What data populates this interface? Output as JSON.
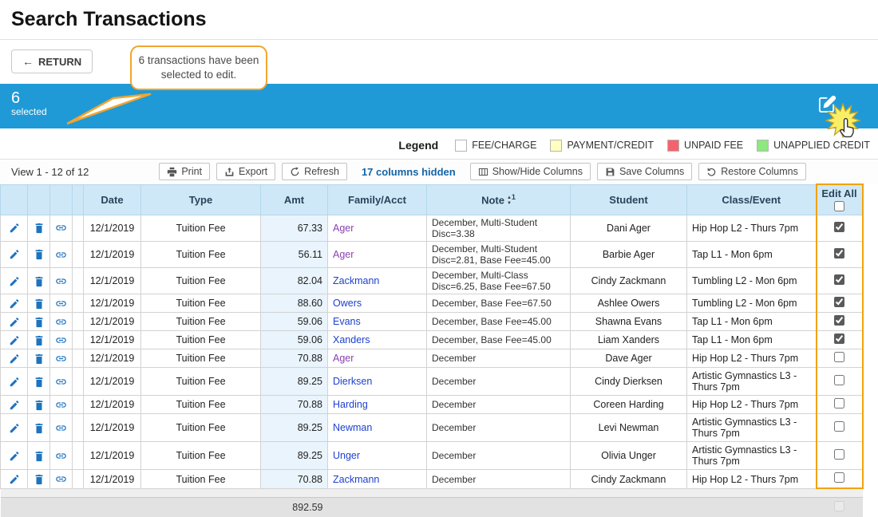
{
  "page_title": "Search Transactions",
  "return_button": {
    "label": "RETURN"
  },
  "callout": {
    "text": "6 transactions have been selected to edit."
  },
  "selection_bar": {
    "count": "6",
    "label": "selected"
  },
  "colors": {
    "selection_bar_blue": "#1f9ad6",
    "highlight_orange": "#f0a30a"
  },
  "legend": {
    "title": "Legend",
    "items": [
      {
        "label": "FEE/CHARGE",
        "color": "#ffffff"
      },
      {
        "label": "PAYMENT/CREDIT",
        "color": "#ffffc2"
      },
      {
        "label": "UNPAID FEE",
        "color": "#f4636d"
      },
      {
        "label": "UNAPPLIED CREDIT",
        "color": "#8ce87f"
      }
    ]
  },
  "toolbar": {
    "view_text": "View 1 - 12 of 12",
    "print_label": "Print",
    "export_label": "Export",
    "refresh_label": "Refresh",
    "columns_hidden_label": "17 columns hidden",
    "show_hide_label": "Show/Hide Columns",
    "save_label": "Save Columns",
    "restore_label": "Restore Columns"
  },
  "table": {
    "headers": {
      "date": "Date",
      "type": "Type",
      "amt": "Amt",
      "family": "Family/Acct",
      "note": "Note",
      "note_superscript": "1",
      "student": "Student",
      "class_event": "Class/Event",
      "edit_all": "Edit All"
    },
    "rows": [
      {
        "date": "12/1/2019",
        "type": "Tuition Fee",
        "amt": "67.33",
        "family": "Ager",
        "visited": true,
        "note": "December, Multi-Student Disc=3.38",
        "student": "Dani Ager",
        "class_event": "Hip Hop L2 - Thurs 7pm",
        "checked": true
      },
      {
        "date": "12/1/2019",
        "type": "Tuition Fee",
        "amt": "56.11",
        "family": "Ager",
        "visited": true,
        "note": "December, Multi-Student Disc=2.81, Base Fee=45.00",
        "student": "Barbie Ager",
        "class_event": "Tap L1 - Mon 6pm",
        "checked": true
      },
      {
        "date": "12/1/2019",
        "type": "Tuition Fee",
        "amt": "82.04",
        "family": "Zackmann",
        "visited": false,
        "note": "December, Multi-Class Disc=6.25, Base Fee=67.50",
        "student": "Cindy Zackmann",
        "class_event": "Tumbling L2 - Mon 6pm",
        "checked": true
      },
      {
        "date": "12/1/2019",
        "type": "Tuition Fee",
        "amt": "88.60",
        "family": "Owers",
        "visited": false,
        "note": "December, Base Fee=67.50",
        "student": "Ashlee Owers",
        "class_event": "Tumbling L2 - Mon 6pm",
        "checked": true
      },
      {
        "date": "12/1/2019",
        "type": "Tuition Fee",
        "amt": "59.06",
        "family": "Evans",
        "visited": false,
        "note": "December, Base Fee=45.00",
        "student": "Shawna Evans",
        "class_event": "Tap L1 - Mon 6pm",
        "checked": true
      },
      {
        "date": "12/1/2019",
        "type": "Tuition Fee",
        "amt": "59.06",
        "family": "Xanders",
        "visited": false,
        "note": "December, Base Fee=45.00",
        "student": "Liam Xanders",
        "class_event": "Tap L1 - Mon 6pm",
        "checked": true
      },
      {
        "date": "12/1/2019",
        "type": "Tuition Fee",
        "amt": "70.88",
        "family": "Ager",
        "visited": true,
        "note": "December",
        "student": "Dave Ager",
        "class_event": "Hip Hop L2 - Thurs 7pm",
        "checked": false
      },
      {
        "date": "12/1/2019",
        "type": "Tuition Fee",
        "amt": "89.25",
        "family": "Dierksen",
        "visited": false,
        "note": "December",
        "student": "Cindy Dierksen",
        "class_event": "Artistic Gymnastics L3 - Thurs 7pm",
        "checked": false
      },
      {
        "date": "12/1/2019",
        "type": "Tuition Fee",
        "amt": "70.88",
        "family": "Harding",
        "visited": false,
        "note": "December",
        "student": "Coreen Harding",
        "class_event": "Hip Hop L2 - Thurs 7pm",
        "checked": false
      },
      {
        "date": "12/1/2019",
        "type": "Tuition Fee",
        "amt": "89.25",
        "family": "Newman",
        "visited": false,
        "note": "December",
        "student": "Levi Newman",
        "class_event": "Artistic Gymnastics L3 - Thurs 7pm",
        "checked": false
      },
      {
        "date": "12/1/2019",
        "type": "Tuition Fee",
        "amt": "89.25",
        "family": "Unger",
        "visited": false,
        "note": "December",
        "student": "Olivia Unger",
        "class_event": "Artistic Gymnastics L3 - Thurs 7pm",
        "checked": false
      },
      {
        "date": "12/1/2019",
        "type": "Tuition Fee",
        "amt": "70.88",
        "family": "Zackmann",
        "visited": false,
        "note": "December",
        "student": "Cindy Zackmann",
        "class_event": "Hip Hop L2 - Thurs 7pm",
        "checked": false
      }
    ],
    "footer": {
      "total_amt": "892.59"
    }
  }
}
